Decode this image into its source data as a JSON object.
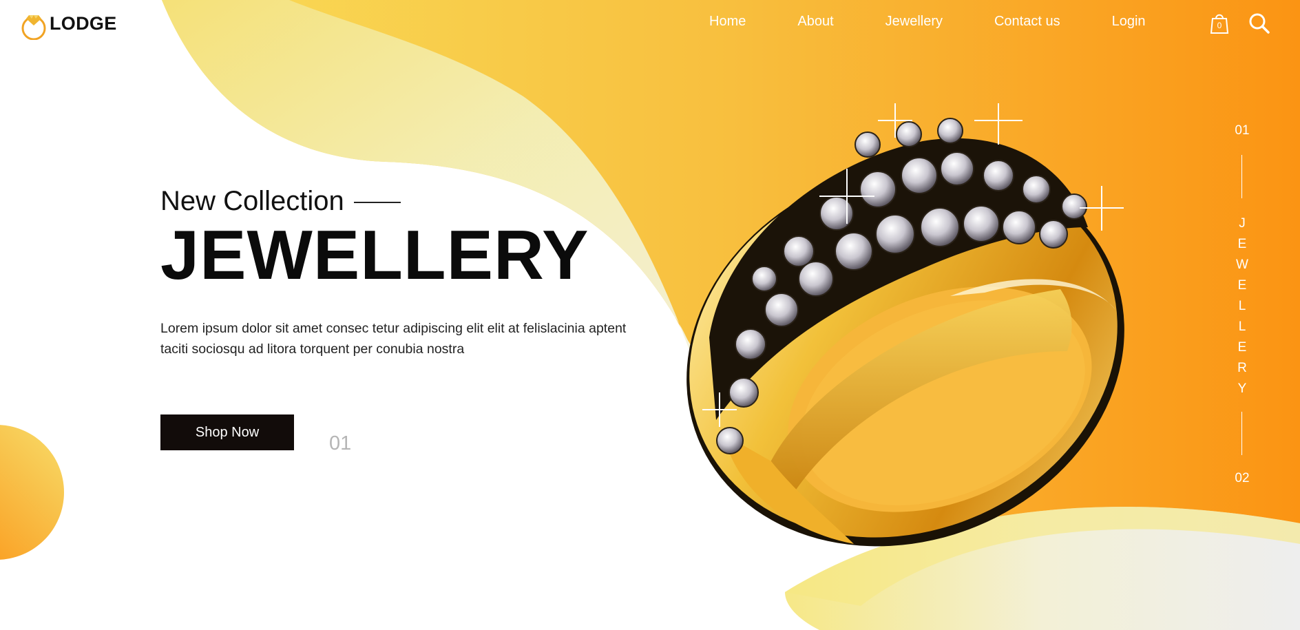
{
  "brand": {
    "name": "LODGE"
  },
  "nav": {
    "items": [
      "Home",
      "About",
      "Jewellery",
      "Contact us",
      "Login"
    ]
  },
  "cart": {
    "count": "0"
  },
  "hero": {
    "subtitle": "New Collection",
    "title": "JEWELLERY",
    "description": "Lorem ipsum dolor sit amet consec tetur adipiscing elit elit at felislacinia aptent taciti sociosqu ad litora torquent per conubia nostra",
    "button_label": "Shop Now",
    "slide_number": "01"
  },
  "side_indicator": {
    "top": "01",
    "letters": [
      "J",
      "E",
      "W",
      "E",
      "L",
      "L",
      "E",
      "R",
      "Y"
    ],
    "bottom": "02"
  },
  "icons": {
    "cart": "shopping-bag-icon",
    "search": "search-icon",
    "logo": "ring-logo-icon"
  },
  "colors": {
    "accent": "#fb9514",
    "light_accent": "#f7d254",
    "button": "#120c0a",
    "pale": "#f0f0c8"
  }
}
